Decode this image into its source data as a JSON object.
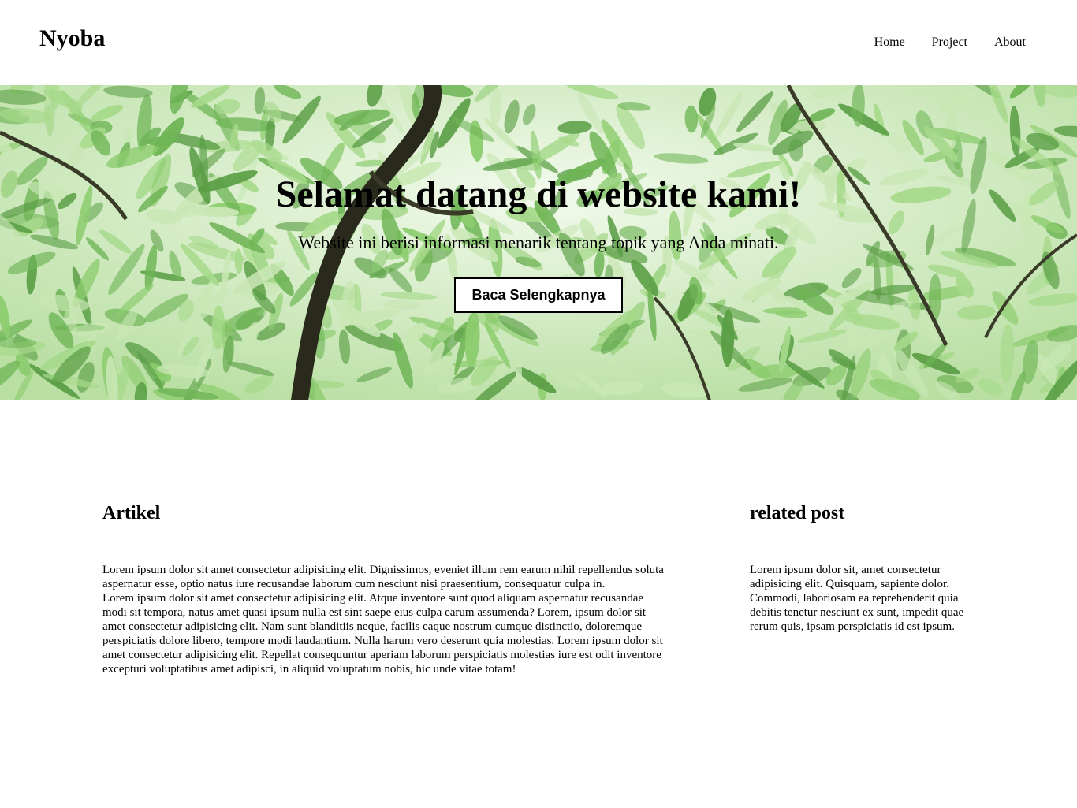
{
  "header": {
    "brand": "Nyoba",
    "nav": [
      "Home",
      "Project",
      "About"
    ]
  },
  "hero": {
    "title": "Selamat datang di website kami!",
    "subtitle": "Website ini berisi informasi menarik tentang topik yang Anda minati.",
    "cta_label": "Baca Selengkapnya",
    "background": "green-leaves-photo"
  },
  "main": {
    "heading": "Artikel",
    "paragraphs": [
      "Lorem ipsum dolor sit amet consectetur adipisicing elit. Dignissimos, eveniet illum rem earum nihil repellendus soluta aspernatur esse, optio natus iure recusandae laborum cum nesciunt nisi praesentium, consequatur culpa in.",
      "Lorem ipsum dolor sit amet consectetur adipisicing elit. Atque inventore sunt quod aliquam aspernatur recusandae modi sit tempora, natus amet quasi ipsum nulla est sint saepe eius culpa earum assumenda? Lorem, ipsum dolor sit amet consectetur adipisicing elit. Nam sunt blanditiis neque, facilis eaque nostrum cumque distinctio, doloremque perspiciatis dolore libero, tempore modi laudantium. Nulla harum vero deserunt quia molestias. Lorem ipsum dolor sit amet consectetur adipisicing elit. Repellat consequuntur aperiam laborum perspiciatis molestias iure est odit inventore excepturi voluptatibus amet adipisci, in aliquid voluptatum nobis, hic unde vitae totam!"
    ]
  },
  "aside": {
    "heading": "related post",
    "text": "Lorem ipsum dolor sit, amet consectetur adipisicing elit. Quisquam, sapiente dolor. Commodi, laboriosam ea reprehenderit quia debitis tenetur nesciunt ex sunt, impedit quae rerum quis, ipsam perspiciatis id est ipsum."
  },
  "colors": {
    "leaf_light": "#c9e7b5",
    "leaf_mid": "#8ccc6e",
    "leaf_dark": "#5a9e45",
    "branch": "#2a2a1c"
  }
}
